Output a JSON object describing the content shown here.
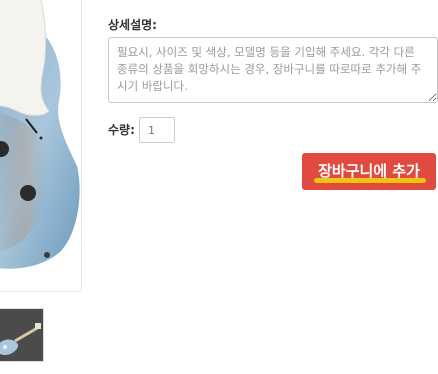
{
  "product_image": {
    "main_alt": "electric guitar body image",
    "thumb_alt": "electric guitar thumbnail"
  },
  "description": {
    "label": "상세설명:",
    "placeholder": "필요시, 사이즈 및 색상, 모델명 등을 기입해 주세요. 각각 다른 종류의 상품을 회망하시는 경우, 장바구니를 따로따로 추가해 주시기 바랍니다."
  },
  "quantity": {
    "label": "수량:",
    "placeholder": "1"
  },
  "cart_button": {
    "label": "장바구니에 추가",
    "color": "#e04a3f",
    "underline_color": "#f1c40f"
  }
}
